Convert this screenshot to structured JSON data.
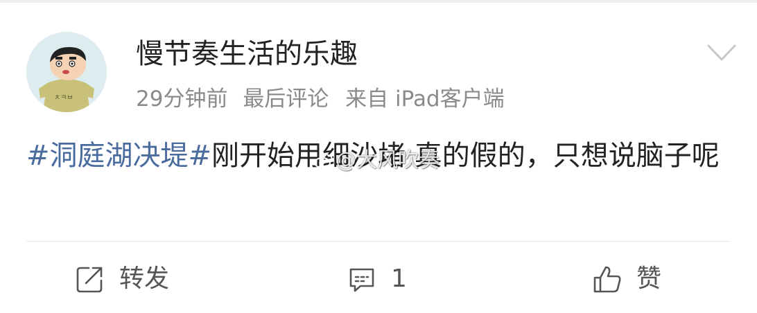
{
  "post": {
    "username": "慢节奏生活的乐趣",
    "meta": {
      "time": "29分钟前",
      "activity": "最后评论",
      "source": "来自 iPad客户端"
    },
    "body": {
      "hashtag": "#洞庭湖决堤#",
      "text": "刚开始用细沙堵 真的假的，只想说脑子呢"
    },
    "watermark": "@大风吹奏",
    "icons": {
      "avatar": "cartoon-avatar",
      "more": "chevron-down-icon"
    }
  },
  "actions": {
    "repost": {
      "icon": "share-icon",
      "label": "转发"
    },
    "comment": {
      "icon": "comment-icon",
      "label": "1"
    },
    "like": {
      "icon": "thumbs-up-icon",
      "label": "赞"
    }
  },
  "colors": {
    "hashtag": "#4a6b9e",
    "meta_text": "#8a8a8a",
    "body_text": "#222222",
    "icon": "#555555"
  }
}
